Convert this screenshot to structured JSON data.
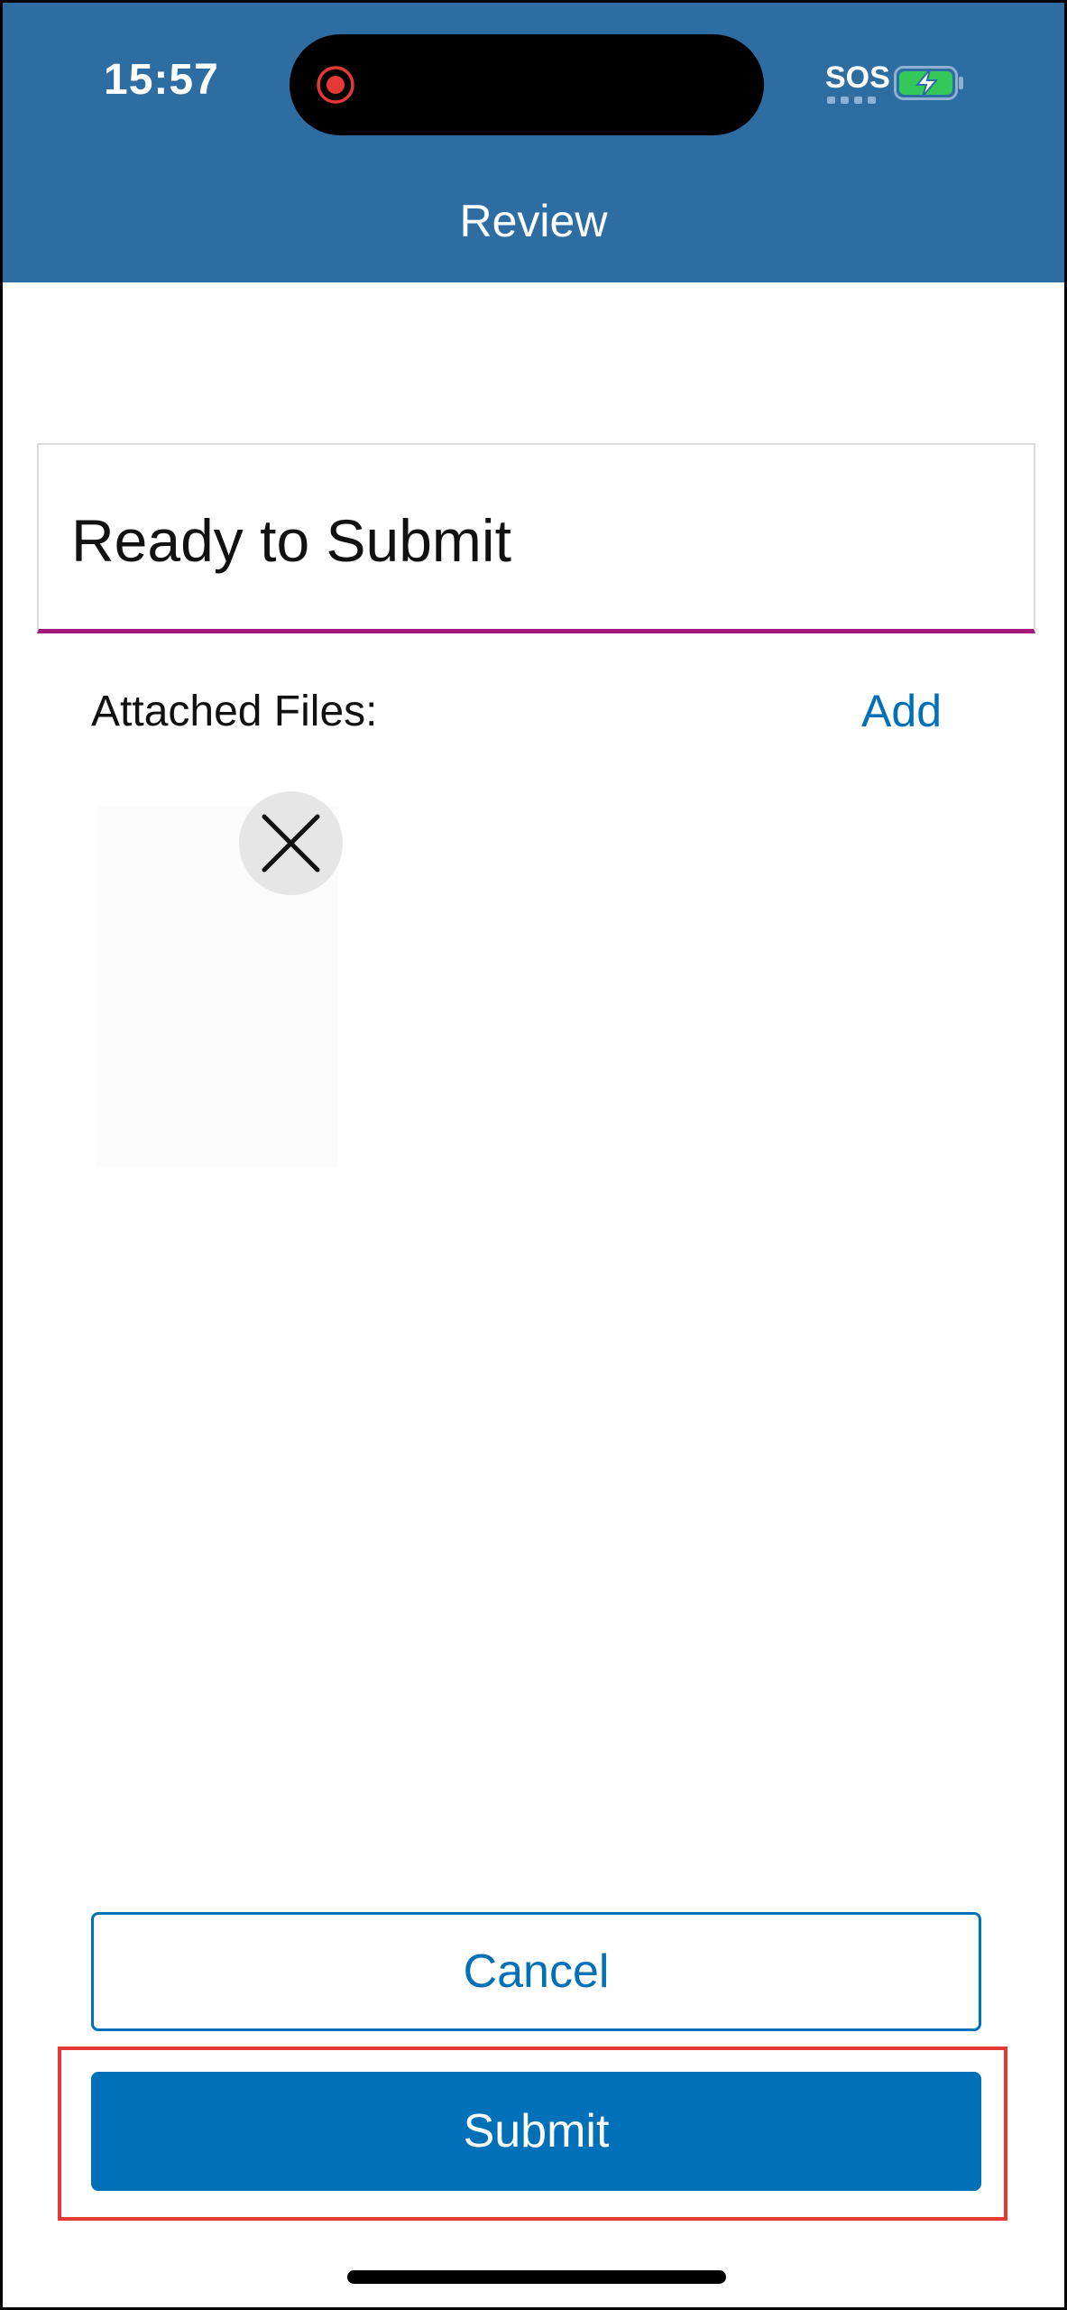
{
  "status_bar": {
    "time": "15:57",
    "sos": "SOS",
    "record_icon": "screen-record-icon",
    "battery_icon": "battery-charging-icon"
  },
  "header": {
    "title": "Review"
  },
  "ready_card": {
    "text": "Ready to Submit",
    "accent_color": "#a0197b"
  },
  "attachments": {
    "label": "Attached Files:",
    "add_label": "Add",
    "remove_icon": "close-icon"
  },
  "actions": {
    "cancel_label": "Cancel",
    "submit_label": "Submit"
  },
  "colors": {
    "header_bg": "#2e6da1",
    "primary": "#0070b8",
    "highlight": "#e53935"
  }
}
